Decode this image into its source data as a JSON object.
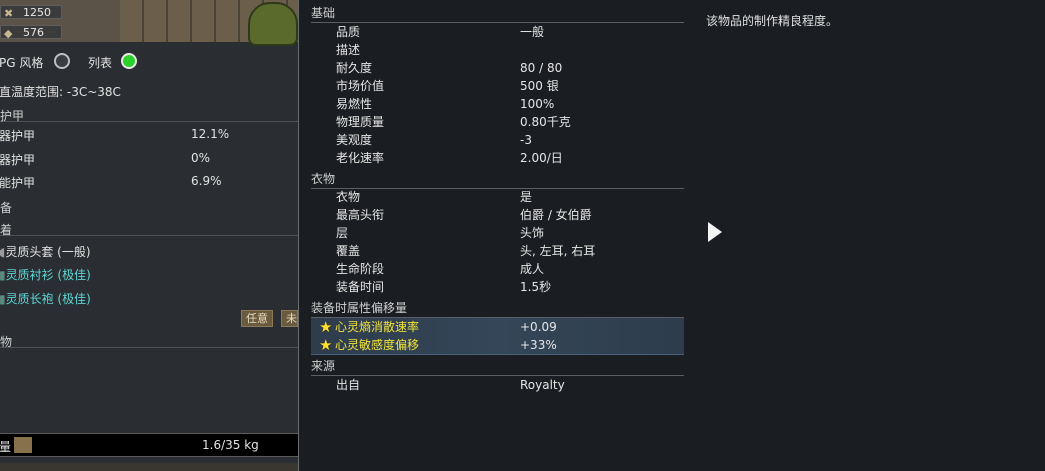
{
  "resources": [
    {
      "icon": "x-wood-icon",
      "value": "1250"
    },
    {
      "icon": "stone-icon",
      "value": "576"
    }
  ],
  "view_toggle": {
    "rpg_label": "PG 风格",
    "list_label": "列表"
  },
  "comfort_range": "直温度范围: -3C~38C",
  "armor": {
    "header": "护甲",
    "rows": [
      {
        "label": "器护甲",
        "value": "12.1%"
      },
      {
        "label": "器护甲",
        "value": "0%"
      },
      {
        "label": "能护甲",
        "value": "6.9%"
      }
    ]
  },
  "equipment_header": "备",
  "apparel": {
    "header": "着",
    "items": [
      {
        "icon": "helmet-icon",
        "label": "灵质头套 (一般)",
        "color": "#e2e2e2"
      },
      {
        "icon": "shirt-icon",
        "label": "灵质衬衫 (极佳)",
        "color": "#5fd6d6"
      },
      {
        "icon": "robe-icon",
        "label": "灵质长袍 (极佳)",
        "color": "#5fd6d6"
      }
    ],
    "buttons": [
      "任意",
      "未"
    ]
  },
  "inventory_header": "物",
  "mass": {
    "label": "量",
    "value": "1.6/35 kg",
    "fill_fraction": 0.046
  },
  "sections": [
    {
      "title": "基础",
      "rows": [
        {
          "label": "品质",
          "value": "一般"
        },
        {
          "label": "描述",
          "value": ""
        },
        {
          "label": "耐久度",
          "value": "80 / 80"
        },
        {
          "label": "市场价值",
          "value": "500 银"
        },
        {
          "label": "易燃性",
          "value": "100%"
        },
        {
          "label": "物理质量",
          "value": "0.80千克"
        },
        {
          "label": "美观度",
          "value": "-3"
        },
        {
          "label": "老化速率",
          "value": "2.00/日"
        }
      ]
    },
    {
      "title": "衣物",
      "rows": [
        {
          "label": "衣物",
          "value": "是"
        },
        {
          "label": "最高头衔",
          "value": "伯爵 / 女伯爵"
        },
        {
          "label": "层",
          "value": "头饰"
        },
        {
          "label": "覆盖",
          "value": "头, 左耳, 右耳"
        },
        {
          "label": "生命阶段",
          "value": "成人"
        },
        {
          "label": "装备时间",
          "value": "1.5秒"
        }
      ]
    },
    {
      "title": "装备时属性偏移量",
      "rows": [
        {
          "label": "心灵熵消散速率",
          "value": "+0.09",
          "highlight": true,
          "icon": "star-icon"
        },
        {
          "label": "心灵敏感度偏移",
          "value": "+33%",
          "highlight": true,
          "icon": "star-icon"
        }
      ]
    },
    {
      "title": "来源",
      "rows": [
        {
          "label": "出自",
          "value": "Royalty"
        }
      ]
    }
  ],
  "description": "该物品的制作精良程度。"
}
